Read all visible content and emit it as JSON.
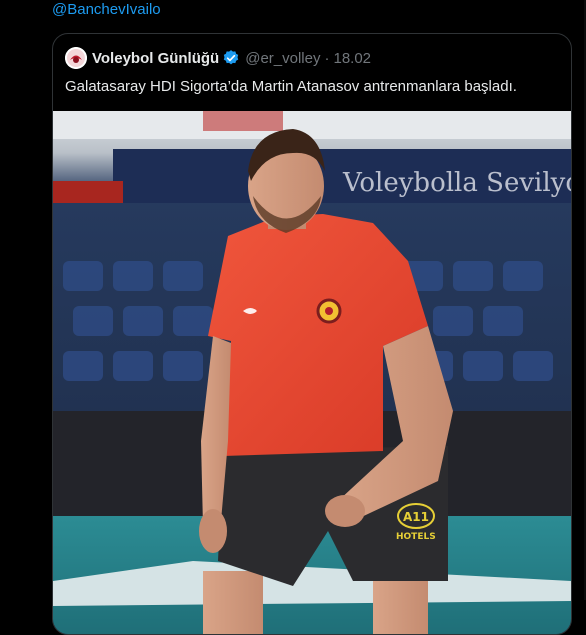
{
  "mention": "@BanchevIvailo",
  "quote": {
    "author_name": "Voleybol Günlüğü",
    "author_handle": "@er_volley",
    "separator": "·",
    "time": "18.02",
    "text": "Galatasaray HDI Sigorta’da Martin Atanasov antrenmanlara başladı.",
    "photo": {
      "banner_text": "Voleybolla Sevilyo",
      "jersey_logo_text": "A11",
      "shorts_text": "HOTELS"
    }
  },
  "colors": {
    "background": "#000000",
    "link": "#1d9bf0",
    "muted": "#71767b",
    "verified": "#1d9bf0",
    "jersey": "#e8452f"
  },
  "icons": {
    "verified": "verified-badge-icon",
    "avatar": "avatar-logo"
  }
}
